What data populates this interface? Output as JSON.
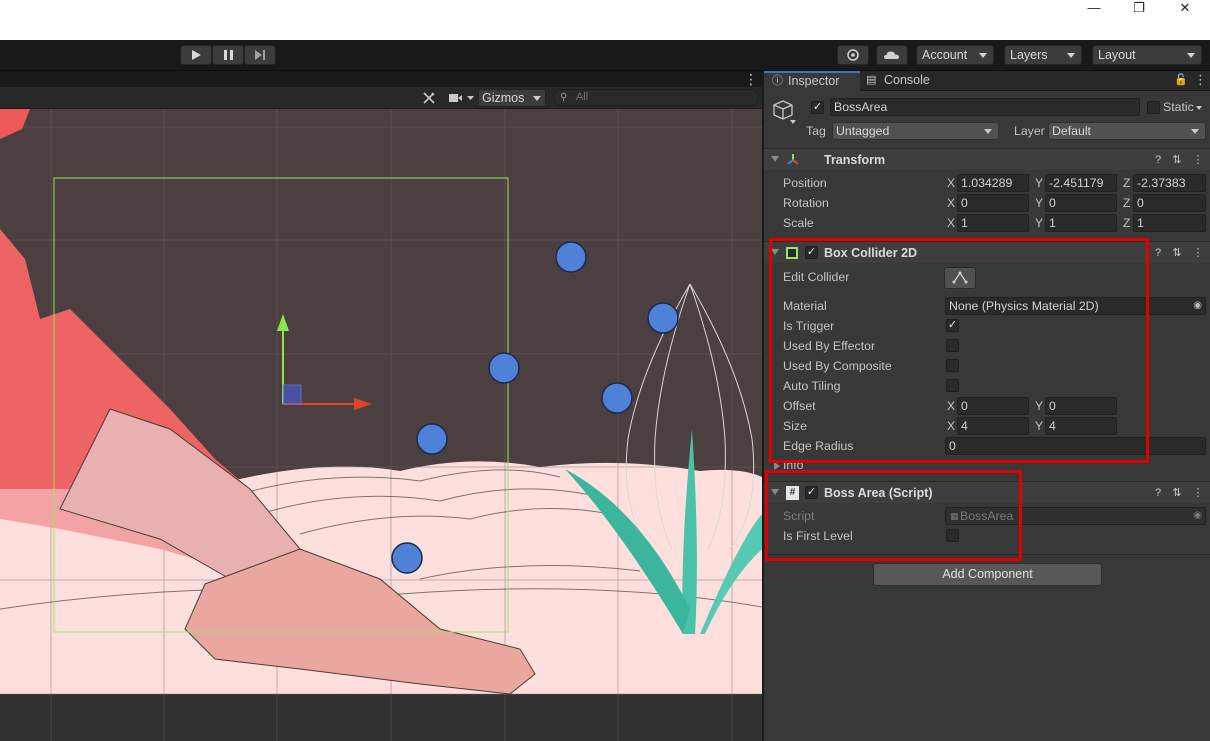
{
  "window": {
    "minimize_glyph": "—",
    "maximize_glyph": "❐",
    "close_glyph": "✕"
  },
  "toolbar": {
    "play_icon": "play-icon",
    "pause_icon": "pause-icon",
    "step_icon": "step-icon",
    "account_label": "Account",
    "layers_label": "Layers",
    "layout_label": "Layout"
  },
  "scene": {
    "menu_glyph": "⋮",
    "gizmos_label": "Gizmos",
    "search_placeholder": "All"
  },
  "inspector": {
    "tabs": [
      {
        "label": "Inspector",
        "icon": "info-icon",
        "active": true
      },
      {
        "label": "Console",
        "icon": "console-icon",
        "active": false
      }
    ],
    "object": {
      "active": true,
      "name": "BossArea",
      "static_label": "Static",
      "tag_label": "Tag",
      "tag_value": "Untagged",
      "layer_label": "Layer",
      "layer_value": "Default"
    },
    "transform": {
      "title": "Transform",
      "rows": [
        {
          "label": "Position",
          "x": "1.034289",
          "y": "-2.451179",
          "z": "-2.37383"
        },
        {
          "label": "Rotation",
          "x": "0",
          "y": "0",
          "z": "0"
        },
        {
          "label": "Scale",
          "x": "1",
          "y": "1",
          "z": "1"
        }
      ]
    },
    "box_collider": {
      "title": "Box Collider 2D",
      "enabled": true,
      "edit_collider_label": "Edit Collider",
      "material_label": "Material",
      "material_value": "None (Physics Material 2D)",
      "is_trigger_label": "Is Trigger",
      "is_trigger": true,
      "used_by_effector_label": "Used By Effector",
      "used_by_effector": false,
      "used_by_composite_label": "Used By Composite",
      "used_by_composite": false,
      "auto_tiling_label": "Auto Tiling",
      "auto_tiling": false,
      "offset_label": "Offset",
      "offset_x": "0",
      "offset_y": "0",
      "size_label": "Size",
      "size_x": "4",
      "size_y": "4",
      "edge_radius_label": "Edge Radius",
      "edge_radius": "0",
      "info_label": "Info"
    },
    "boss_area": {
      "title": "Boss Area (Script)",
      "enabled": true,
      "script_label": "Script",
      "script_value": "BossArea",
      "is_first_level_label": "Is First Level",
      "is_first_level": false
    },
    "add_component_label": "Add Component"
  },
  "axes": {
    "x": "X",
    "y": "Y",
    "z": "Z"
  },
  "colors": {
    "accent": "#3a79bb",
    "highlight": "#e00000",
    "collider": "#9be36a"
  }
}
